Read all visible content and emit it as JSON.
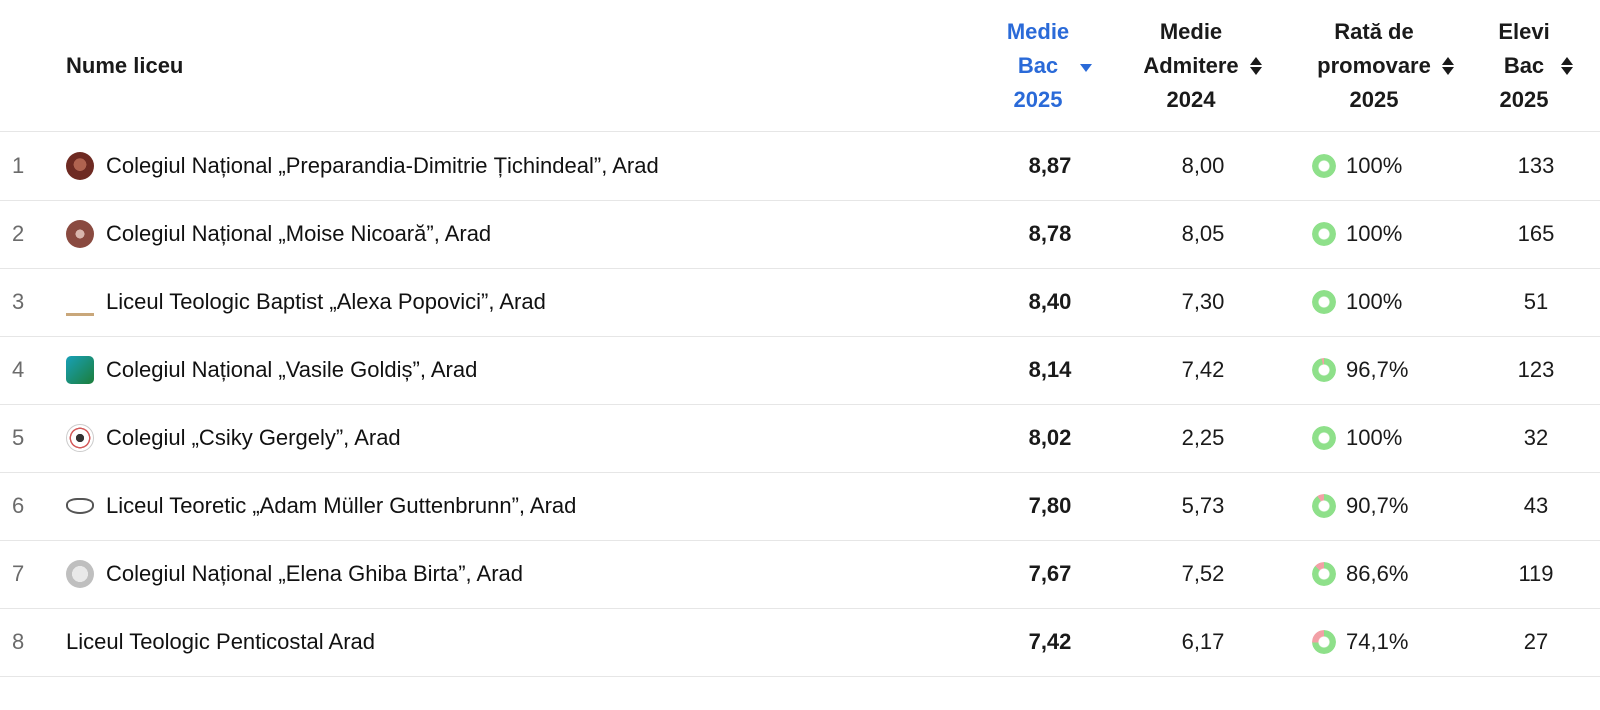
{
  "header": {
    "name": "Nume liceu",
    "bac": [
      "Medie",
      "Bac",
      "2025"
    ],
    "admitere": [
      "Medie",
      "Admitere",
      "2024"
    ],
    "rate": [
      "Rată de",
      "promovare",
      "2025"
    ],
    "elevi": [
      "Elevi",
      "Bac",
      "2025"
    ]
  },
  "colors": {
    "accent": "#2a6ad8",
    "pass": "#8ee08a",
    "fail": "#f2a0a6"
  },
  "rows": [
    {
      "rank": "1",
      "name": "Colegiul Național „Preparandia-Dimitrie Țichindeal”, Arad",
      "bac": "8,87",
      "admitere": "8,00",
      "rate": "100%",
      "rate_value": 100,
      "elevi": "133",
      "logo": "seal-dark-icon"
    },
    {
      "rank": "2",
      "name": "Colegiul Național „Moise Nicoară”, Arad",
      "bac": "8,78",
      "admitere": "8,05",
      "rate": "100%",
      "rate_value": 100,
      "elevi": "165",
      "logo": "crest-brown-icon"
    },
    {
      "rank": "3",
      "name": "Liceul Teologic Baptist „Alexa Popovici”, Arad",
      "bac": "8,40",
      "admitere": "7,30",
      "rate": "100%",
      "rate_value": 100,
      "elevi": "51",
      "logo": "church-icon"
    },
    {
      "rank": "4",
      "name": "Colegiul Național „Vasile Goldiș”, Arad",
      "bac": "8,14",
      "admitere": "7,42",
      "rate": "96,7%",
      "rate_value": 96.7,
      "elevi": "123",
      "logo": "vg-logo-icon"
    },
    {
      "rank": "5",
      "name": "Colegiul „Csiky Gergely”, Arad",
      "bac": "8,02",
      "admitere": "2,25",
      "rate": "100%",
      "rate_value": 100,
      "elevi": "32",
      "logo": "round-seal-icon"
    },
    {
      "rank": "6",
      "name": "Liceul Teoretic „Adam Müller Guttenbrunn”, Arad",
      "bac": "7,80",
      "admitere": "5,73",
      "rate": "90,7%",
      "rate_value": 90.7,
      "elevi": "43",
      "logo": "glasses-icon"
    },
    {
      "rank": "7",
      "name": "Colegiul Național „Elena Ghiba Birta”, Arad",
      "bac": "7,67",
      "admitere": "7,52",
      "rate": "86,6%",
      "rate_value": 86.6,
      "elevi": "119",
      "logo": "grey-seal-icon"
    },
    {
      "rank": "8",
      "name": "Liceul Teologic Penticostal Arad",
      "bac": "7,42",
      "admitere": "6,17",
      "rate": "74,1%",
      "rate_value": 74.1,
      "elevi": "27",
      "logo": ""
    }
  ]
}
